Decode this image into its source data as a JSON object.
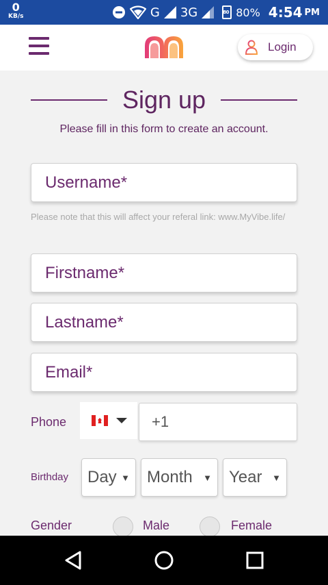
{
  "status_bar": {
    "speed_value": "0",
    "speed_unit": "KB/s",
    "network_g": "G",
    "network_3g": "3G",
    "battery_badge": "80",
    "battery_percent": "80%",
    "time": "4:54",
    "ampm": "PM"
  },
  "header": {
    "login_label": "Login"
  },
  "form": {
    "title": "Sign up",
    "subtitle": "Please fill in this form to create an account.",
    "username_placeholder": "Username*",
    "username_note": "Please note that this will affect your referal link: www.MyVibe.life/",
    "firstname_placeholder": "Firstname*",
    "lastname_placeholder": "Lastname*",
    "email_placeholder": "Email*",
    "phone_label": "Phone",
    "phone_value": "+1",
    "phone_flag": "canada-flag-icon",
    "birthday_label": "Birthday",
    "day_value": "Day",
    "month_value": "Month",
    "year_value": "Year",
    "gender_label": "Gender",
    "gender_options": [
      "Male",
      "Female"
    ]
  },
  "colors": {
    "status_bar": "#1c4ba0",
    "brand_purple": "#6b2a6e",
    "background": "#f2f2f2"
  }
}
